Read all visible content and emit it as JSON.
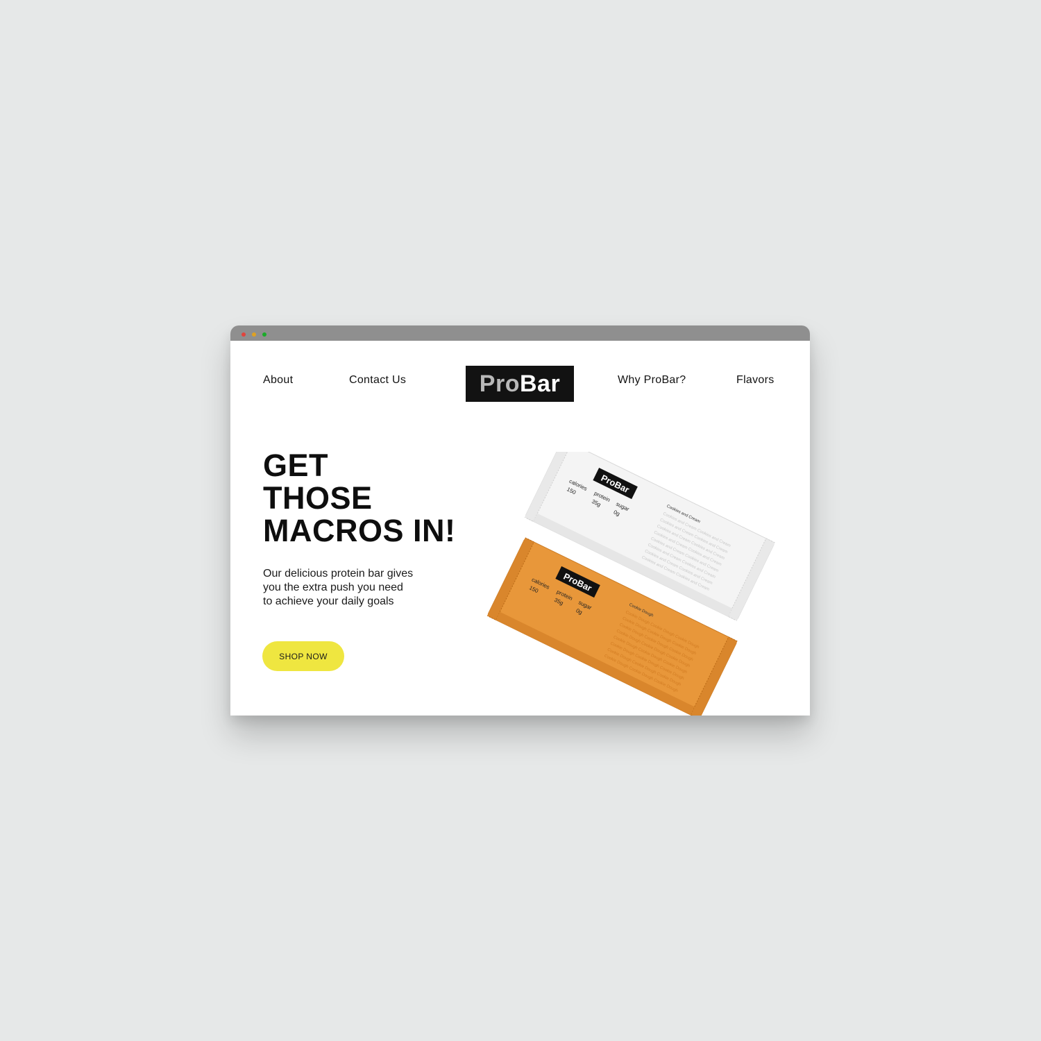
{
  "nav": {
    "left": [
      "About",
      "Contact Us"
    ],
    "right": [
      "Why ProBar?",
      "Flavors"
    ]
  },
  "logo": {
    "pro": "Pro",
    "bar": "Bar"
  },
  "hero": {
    "headline": [
      "GET",
      "THOSE",
      "MACROS IN!"
    ],
    "subtext": [
      "Our delicious protein bar gives",
      "you the extra push you need",
      "to achieve your daily goals"
    ],
    "cta": "SHOP NOW"
  },
  "products": {
    "white_bar": {
      "brand": "ProBar",
      "nutrition_labels": [
        "calories",
        "protein",
        "sugar"
      ],
      "nutrition_values": [
        "150",
        "35g",
        "0g"
      ],
      "flavor": "Cookies and Cream",
      "color": "#f4f4f4"
    },
    "orange_bar": {
      "brand": "ProBar",
      "nutrition_labels": [
        "calories",
        "protein",
        "sugar"
      ],
      "nutrition_values": [
        "150",
        "35g",
        "0g"
      ],
      "flavor": "Cookie Dough",
      "color": "#e8973a"
    }
  },
  "colors": {
    "background": "#e6e8e8",
    "titlebar": "#8f8f8f",
    "accent_button": "#efe640",
    "logo_bg": "#121212"
  }
}
